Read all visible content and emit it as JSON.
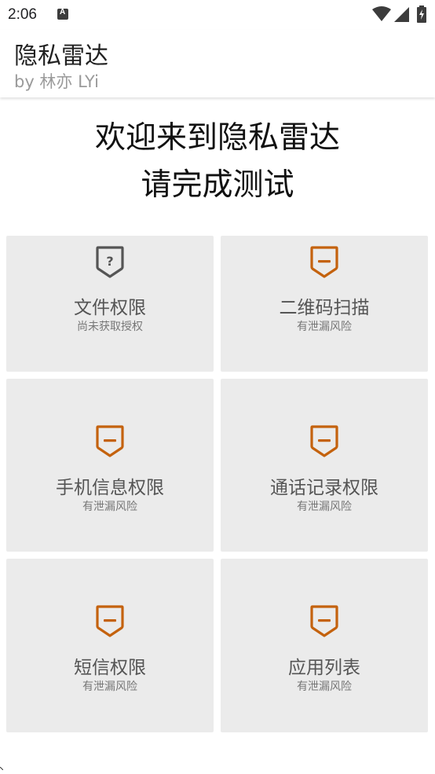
{
  "status_bar": {
    "time": "2:06",
    "notification_icon": "a-box-icon",
    "wifi_icon": "wifi-icon",
    "signal_icon": "cell-signal-icon",
    "battery_icon": "battery-charging-icon"
  },
  "app_bar": {
    "title": "隐私雷达",
    "subtitle": "by 林亦 LYi"
  },
  "welcome": {
    "line1": "欢迎来到隐私雷达",
    "line2": "请完成测试"
  },
  "colors": {
    "warning": "#c4620e",
    "unknown": "#555555",
    "card_bg": "#ebebeb"
  },
  "cards": [
    {
      "title": "文件权限",
      "status": "尚未获取授权",
      "icon": "question-shield-icon"
    },
    {
      "title": "二维码扫描",
      "status": "有泄漏风险",
      "icon": "minus-shield-icon"
    },
    {
      "title": "手机信息权限",
      "status": "有泄漏风险",
      "icon": "minus-shield-icon"
    },
    {
      "title": "通话记录权限",
      "status": "有泄漏风险",
      "icon": "minus-shield-icon"
    },
    {
      "title": "短信权限",
      "status": "有泄漏风险",
      "icon": "minus-shield-icon"
    },
    {
      "title": "应用列表",
      "status": "有泄漏风险",
      "icon": "minus-shield-icon"
    }
  ]
}
